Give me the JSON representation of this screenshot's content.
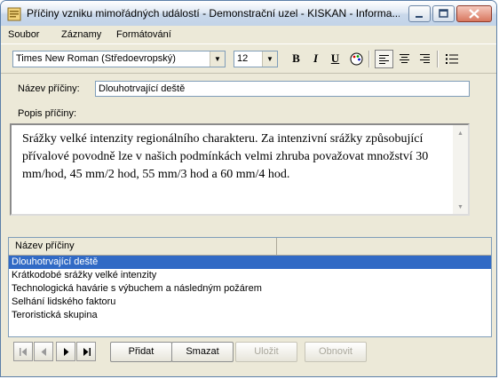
{
  "window": {
    "title": "Příčiny vzniku mimořádných událostí - Demonstrační uzel - KISKAN - Informa..."
  },
  "menu": [
    "Soubor",
    "Záznamy",
    "Formátování"
  ],
  "toolbar": {
    "font_value": "Times New Roman (Středoevropský)",
    "size_value": "12",
    "bold_label": "B",
    "italic_label": "I",
    "underline_label": "U"
  },
  "form": {
    "name_label": "Název příčiny:",
    "name_value": "Dlouhotrvající deště",
    "desc_label": "Popis příčiny:",
    "desc_value": "Srážky velké intenzity regionálního charakteru. Za intenzivní srážky způsobující přívalové povodně lze v našich podmínkách velmi zhruba považovat množství 30 mm/hod, 45 mm/2 hod, 55 mm/3 hod a 60 mm/4 hod."
  },
  "list": {
    "column_header": "Název příčiny",
    "rows": [
      "Dlouhotrvající deště",
      "Krátkodobé srážky velké intenzity",
      "Technologická havárie s výbuchem a následným požárem",
      "Selhání lidského faktoru",
      "Teroristická skupina"
    ],
    "selected_index": 0
  },
  "actions": {
    "add_label": "Přidat",
    "delete_label": "Smazat",
    "save_label": "Uložit",
    "restore_label": "Obnovit"
  },
  "colors": {
    "selection": "#316ac5",
    "window_bg": "#ece9d8"
  }
}
